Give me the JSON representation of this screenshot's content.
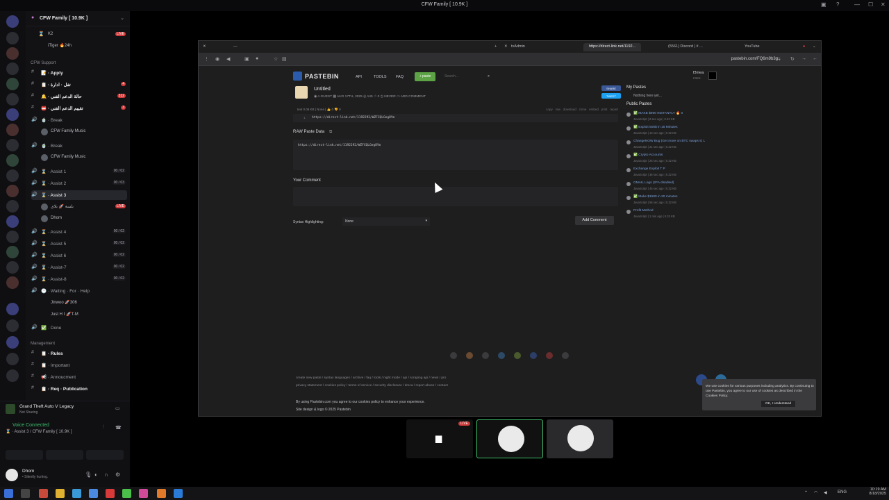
{
  "window": {
    "title": "CFW Family [ 10.9K ]"
  },
  "server": {
    "name": "CFW Family [ 10.9K ]",
    "pinned_channels": [
      {
        "icon": "⌛",
        "label": "K2"
      },
      {
        "icon": "",
        "label": "iTiger 🔥24h"
      }
    ],
    "support_category": "CFW Support",
    "channels": [
      {
        "icon": "#",
        "label": "📝 · Apply",
        "bold": true
      },
      {
        "icon": "#",
        "label": "📋 · تفل · ادارة",
        "bold": true,
        "badge": "4"
      },
      {
        "icon": "#",
        "label": "🔔 · حالة الدعم الفني",
        "bold": true,
        "badge": "312"
      },
      {
        "icon": "#",
        "label": "📛 · تقييم الدعم الفني",
        "bold": true,
        "badge": "3"
      },
      {
        "icon": "🔊",
        "label": "🍵 · Break"
      },
      {
        "icon": "",
        "label": "CFW Family Music",
        "sub": true
      },
      {
        "icon": "🔊",
        "label": "🍵 · Break"
      },
      {
        "icon": "",
        "label": "CFW Family Music",
        "sub": true
      },
      {
        "icon": "🔊",
        "label": "⌛ · Assist 1",
        "count": "00 / 02"
      },
      {
        "icon": "🔊",
        "label": "⌛ · Assist 2",
        "count": "00 / 03"
      },
      {
        "icon": "🔊",
        "label": "⌛ · Assist 3",
        "active": true
      },
      {
        "icon": "",
        "label": "بلسة 🚀 بلاي",
        "user": true,
        "live": "LIVE"
      },
      {
        "icon": "",
        "label": "Dhom",
        "user": true
      },
      {
        "icon": "🔊",
        "label": "⌛ · Assist 4",
        "count": "00 / 02"
      },
      {
        "icon": "🔊",
        "label": "⌛ · Assist 5",
        "count": "00 / 02"
      },
      {
        "icon": "🔊",
        "label": "⌛ · Assist 6",
        "count": "00 / 02"
      },
      {
        "icon": "🔊",
        "label": "⌛ · Assist-7",
        "count": "00 / 02"
      },
      {
        "icon": "🔊",
        "label": "⌛ · Assist-8",
        "count": "00 / 02"
      },
      {
        "icon": "🔊",
        "label": "🕐 · Waiting · For · Help"
      },
      {
        "icon": "",
        "label": "Jinwoo 🚀306",
        "user": true
      },
      {
        "icon": "",
        "label": "Just H I 🚀T-M",
        "user": true
      },
      {
        "icon": "🔊",
        "label": "✅ · Done"
      }
    ],
    "management_category": "Management",
    "management_channels": [
      {
        "icon": "#",
        "label": "📋 · Rules",
        "bold": true
      },
      {
        "icon": "#",
        "label": "📋 · Important"
      },
      {
        "icon": "#",
        "label": "📢 · Annoucment"
      },
      {
        "icon": "#",
        "label": "📋 · Req · Publication",
        "bold": true
      }
    ]
  },
  "voice_panel": {
    "activity_title": "Grand Theft Auto V Legacy",
    "activity_sub": "Not Sharing",
    "status": "Voice Connected",
    "channel": "⌛ · Assist 3 / CFW Family [ 10.9K ]",
    "user_name": "Dhom",
    "user_status": "• Silently hurting."
  },
  "browser": {
    "tabs": [
      {
        "label": "tvAdmin"
      },
      {
        "label": "https://direct-link.net/1192...",
        "active": true
      },
      {
        "label": "(5561) Discord | # ...",
        "active": false
      },
      {
        "label": "YouTube"
      }
    ],
    "url": "pastebin.com/FQ6m9b3g"
  },
  "pastebin": {
    "logo": "PASTEBIN",
    "nav": [
      "API",
      "TOOLS",
      "FAQ"
    ],
    "paste_button": "+ paste",
    "search_placeholder": "Search...",
    "user": "f3mea",
    "user_tag": "FREE",
    "paste_title": "Untitled",
    "meta": {
      "author": "A GUEST",
      "date": "AUG 17TH, 2025",
      "views": "145",
      "stars": "0",
      "expire": "NEVER",
      "add_comment": "ADD COMMENT"
    },
    "toolbar_left": "text   0.06 KB  |  None  |  👍 0  👎 0",
    "toolbar_right": [
      "copy",
      "raw",
      "download",
      "clone",
      "embed",
      "print",
      "report"
    ],
    "line_number": "1.",
    "code": "https://direct-link.net/1192292/WZFCQLGeg8Ym",
    "raw_heading": "RAW Paste Data",
    "raw_code": "https://direct-link.net/1192292/WZFCQLGeg8Ym",
    "comment_heading": "Your Comment",
    "syntax_label": "Syntax Highlighting:",
    "syntax_value": "None",
    "add_comment_button": "Add Comment",
    "share_buttons": [
      "SHARE",
      "TWEET"
    ],
    "my_pastes_heading": "My Pastes",
    "my_pastes_empty": "Nothing here yet...",
    "public_pastes_heading": "Public Pastes",
    "public_pastes": [
      {
        "title": "✅ MAKE $900 INSTANTLY 🔥 0",
        "sub": "JavaScript | 8 sec ago | 0.32 KB"
      },
      {
        "title": "✅ Exploit 500$ in 15 Minutes",
        "sub": "JavaScript | 13 sec ago | 0.32 KB"
      },
      {
        "title": "ChangeNOW Bug (Get more on BTC swaps s) L",
        "sub": "JavaScript | 21 sec ago | 0.32 KB"
      },
      {
        "title": "✅ Crypto Accounts",
        "sub": "JavaScript | 26 sec ago | 0.32 KB"
      },
      {
        "title": "Exchange Exploit T P",
        "sub": "JavaScript | 35 sec ago | 0.32 KB"
      },
      {
        "title": "GMAIL Logs (2FA disabled)",
        "sub": "JavaScript | 45 sec ago | 0.32 KB"
      },
      {
        "title": "✅ Make $1500 in 20 minutes",
        "sub": "JavaScript | 56 sec ago | 0.32 KB"
      },
      {
        "title": "Profit Method",
        "sub": "JavaScript | 1 min ago | 0.32 KB"
      }
    ],
    "footer_links_1": "create new paste  /  syntax languages  /  archive  /  faq  /  tools  /  night mode  /  api  /  scraping api  /  news  /  pro",
    "footer_links_2": "privacy statement  /  cookies policy  /  terms of service  /  security disclosure  /  dmca  /  report abuse  /  contact",
    "agree_text": "By using Pastebin.com you agree to our cookies policy to enhance your experience.",
    "design_text": "Site design & logo © 2025 Pastebin",
    "cookie_text": "We use cookies for various purposes including analytics. By continuing to use Pastebin, you agree to our use of cookies as described in the Cookies Policy.",
    "cookie_button": "OK, I Understand"
  },
  "streams": {
    "live_label": "LIVE"
  },
  "taskbar": {
    "language": "ENG",
    "time": "10:19 AM",
    "date": "8/18/2025"
  }
}
